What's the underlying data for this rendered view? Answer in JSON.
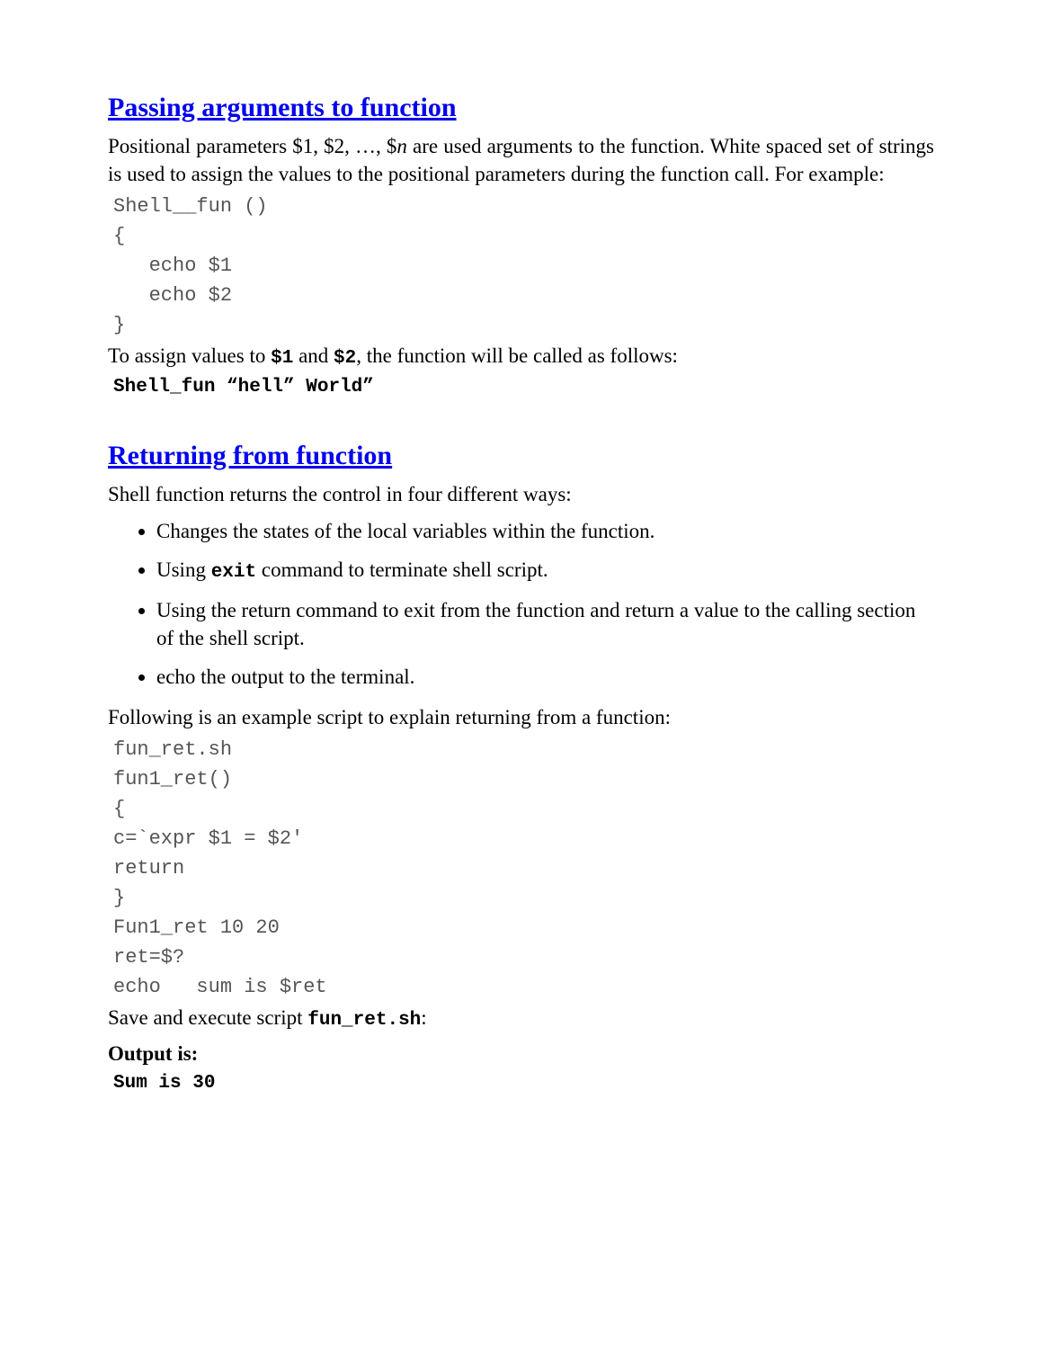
{
  "section1": {
    "title": "Passing arguments to function",
    "intro_a": "Positional parameters $1, $2, …, $",
    "intro_n": "n",
    "intro_b": " are used arguments to the function. White spaced set of strings is used to assign the values to the positional parameters during the function call. For example:",
    "code": "Shell__fun ()\n{\n   echo $1\n   echo $2\n}",
    "text2_a": "To assign values to ",
    "text2_b": " and ",
    "text2_c": ", the function will be called as follows:",
    "var1": "$1",
    "var2": "$2",
    "call_code": "Shell_fun “hell” World”"
  },
  "section2": {
    "title": "Returning from function",
    "intro": "Shell function returns the control in four different ways:",
    "bullets": {
      "0": "Changes the states of the local variables within the function.",
      "1a": "Using ",
      "1cmd": "exit",
      "1b": " command to terminate shell script.",
      "2": "Using the return command to exit from the function and return a value to the calling section of the shell script.",
      "3": "echo the output to the terminal."
    },
    "followup": "Following is an example script to explain returning from a function:",
    "code": "fun_ret.sh\nfun1_ret()\n{\nc=`expr $1 = $2'\nreturn\n}\nFun1_ret 10 20\nret=$?\necho   sum is $ret",
    "save_a": "Save and execute script ",
    "save_file": "fun_ret.sh",
    "save_b": ":",
    "output_label": "Output is:",
    "output": "Sum is 30"
  }
}
